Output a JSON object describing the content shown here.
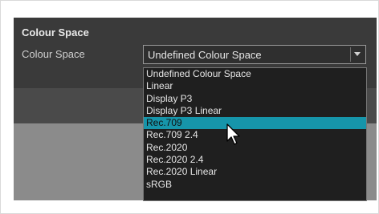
{
  "section": {
    "title": "Colour Space"
  },
  "field": {
    "label": "Colour Space",
    "value": "Undefined Colour Space"
  },
  "dropdown": {
    "options": [
      "Undefined Colour Space",
      "Linear",
      "Display P3",
      "Display P3 Linear",
      "Rec.709",
      "Rec.709 2.4",
      "Rec.2020",
      "Rec.2020 2.4",
      "Rec.2020 Linear",
      "sRGB"
    ],
    "selected_index": 4
  },
  "colors": {
    "panel": "#3a3a3a",
    "highlight": "#1695aa",
    "list_bg": "#1f1f1f"
  },
  "icons": {
    "dropdown_arrow": "chevron-down-icon",
    "pointer": "mouse-pointer-icon"
  }
}
